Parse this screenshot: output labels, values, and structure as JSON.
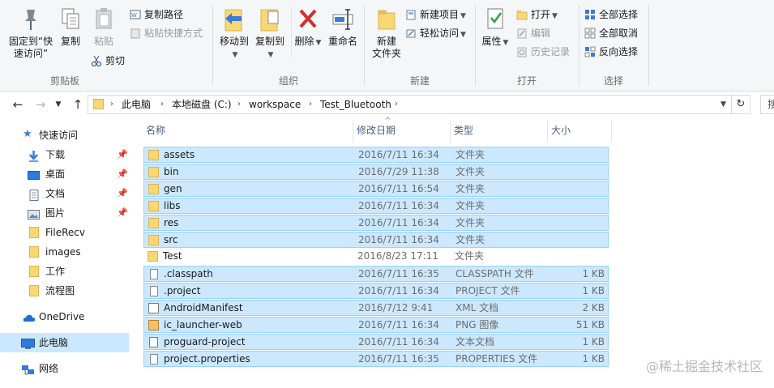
{
  "ribbon": {
    "clipboard": {
      "label": "剪贴板",
      "pin": "固定到“快\n速访问”",
      "copy": "复制",
      "paste": "粘贴",
      "copy_path": "复制路径",
      "paste_shortcut": "粘贴快捷方式",
      "cut": "剪切"
    },
    "organize": {
      "label": "组织",
      "move_to": "移动到",
      "copy_to": "复制到",
      "delete": "删除",
      "rename": "重命名"
    },
    "new": {
      "label": "新建",
      "new_folder": "新建\n文件夹",
      "new_item": "新建项目",
      "easy_access": "轻松访问"
    },
    "open": {
      "label": "打开",
      "properties": "属性",
      "open": "打开",
      "edit": "编辑",
      "history": "历史记录"
    },
    "select": {
      "label": "选择",
      "select_all": "全部选择",
      "select_none": "全部取消",
      "invert": "反向选择"
    }
  },
  "address": {
    "crumbs": [
      "此电脑",
      "本地磁盘 (C:)",
      "workspace",
      "Test_Bluetooth"
    ],
    "search_placeholder": "搜"
  },
  "nav": {
    "quick_access": "快速访问",
    "items": [
      {
        "label": "下载",
        "icon": "download-icon",
        "pinned": true
      },
      {
        "label": "桌面",
        "icon": "desktop-icon",
        "pinned": true
      },
      {
        "label": "文档",
        "icon": "documents-icon",
        "pinned": true
      },
      {
        "label": "图片",
        "icon": "pictures-icon",
        "pinned": true
      },
      {
        "label": "FileRecv",
        "icon": "folder-icon",
        "pinned": false
      },
      {
        "label": "images",
        "icon": "folder-icon",
        "pinned": false
      },
      {
        "label": "工作",
        "icon": "folder-icon",
        "pinned": false
      },
      {
        "label": "流程图",
        "icon": "folder-icon",
        "pinned": false
      }
    ],
    "onedrive": "OneDrive",
    "this_pc": "此电脑",
    "network": "网络"
  },
  "columns": {
    "name": "名称",
    "modified": "修改日期",
    "type": "类型",
    "size": "大小"
  },
  "files": [
    {
      "name": "assets",
      "date": "2016/7/11 16:34",
      "type": "文件夹",
      "size": "",
      "icon": "folder",
      "selected": true
    },
    {
      "name": "bin",
      "date": "2016/7/29 11:38",
      "type": "文件夹",
      "size": "",
      "icon": "folder",
      "selected": true
    },
    {
      "name": "gen",
      "date": "2016/7/11 16:54",
      "type": "文件夹",
      "size": "",
      "icon": "folder",
      "selected": true
    },
    {
      "name": "libs",
      "date": "2016/7/11 16:34",
      "type": "文件夹",
      "size": "",
      "icon": "folder",
      "selected": true
    },
    {
      "name": "res",
      "date": "2016/7/11 16:34",
      "type": "文件夹",
      "size": "",
      "icon": "folder",
      "selected": true
    },
    {
      "name": "src",
      "date": "2016/7/11 16:34",
      "type": "文件夹",
      "size": "",
      "icon": "folder",
      "selected": true
    },
    {
      "name": "Test",
      "date": "2016/8/23 17:11",
      "type": "文件夹",
      "size": "",
      "icon": "folder",
      "selected": false
    },
    {
      "name": ".classpath",
      "date": "2016/7/11 16:35",
      "type": "CLASSPATH 文件",
      "size": "1 KB",
      "icon": "file",
      "selected": true
    },
    {
      "name": ".project",
      "date": "2016/7/11 16:34",
      "type": "PROJECT 文件",
      "size": "1 KB",
      "icon": "file",
      "selected": true
    },
    {
      "name": "AndroidManifest",
      "date": "2016/7/12 9:41",
      "type": "XML 文档",
      "size": "2 KB",
      "icon": "xml",
      "selected": true
    },
    {
      "name": "ic_launcher-web",
      "date": "2016/7/11 16:34",
      "type": "PNG 图像",
      "size": "51 KB",
      "icon": "image",
      "selected": true
    },
    {
      "name": "proguard-project",
      "date": "2016/7/11 16:34",
      "type": "文本文档",
      "size": "1 KB",
      "icon": "text",
      "selected": true
    },
    {
      "name": "project.properties",
      "date": "2016/7/11 16:35",
      "type": "PROPERTIES 文件",
      "size": "1 KB",
      "icon": "file",
      "selected": true
    }
  ],
  "watermark": "@稀土掘金技术社区"
}
